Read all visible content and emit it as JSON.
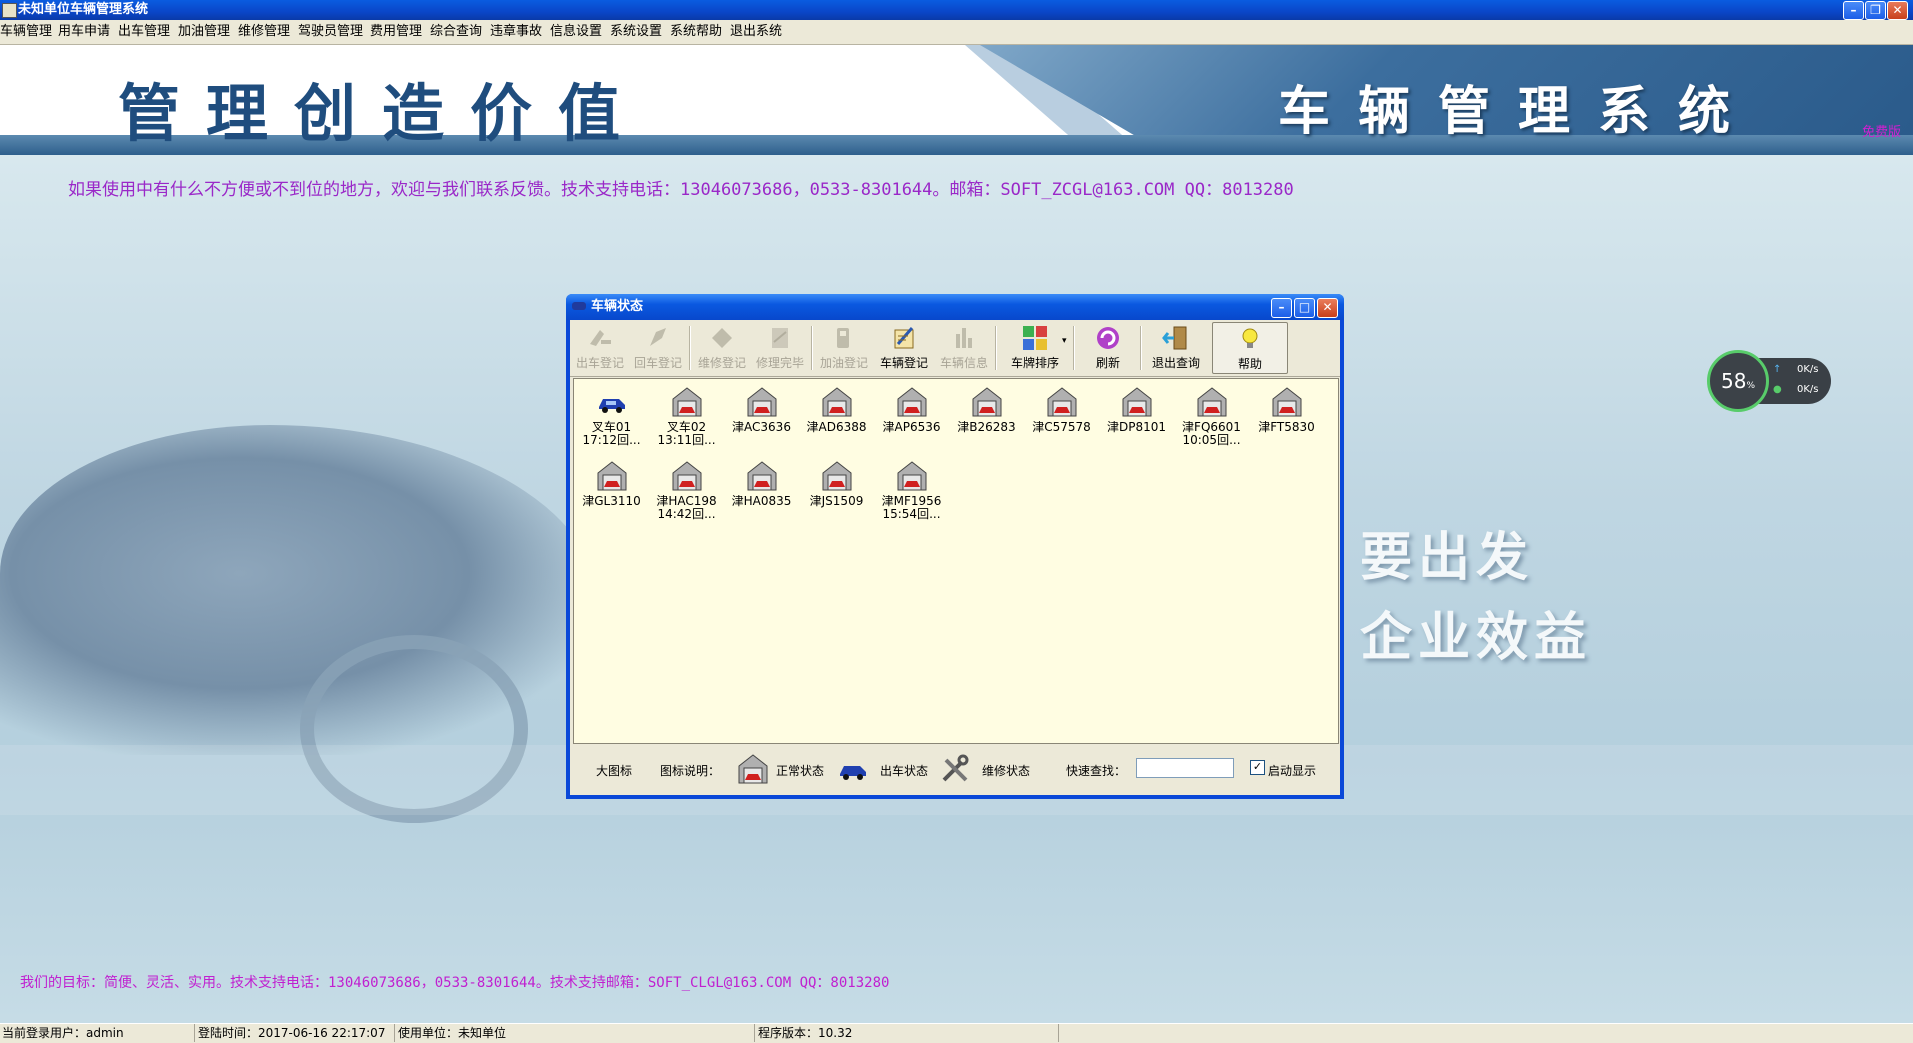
{
  "window": {
    "title": "未知单位车辆管理系统"
  },
  "menu": [
    "车辆管理",
    "用车申请",
    "出车管理",
    "加油管理",
    "维修管理",
    "驾驶员管理",
    "费用管理",
    "综合查询",
    "违章事故",
    "信息设置",
    "系统设置",
    "系统帮助",
    "退出系统"
  ],
  "banner": {
    "slogan": "管理创造价值",
    "system_name": "车辆管理系统",
    "corner_link": "免费版"
  },
  "notice_top": "如果使用中有什么不方便或不到位的地方，欢迎与我们联系反馈。技术支持电话：13046073686，0533-8301644。邮箱：SOFT_ZCGL@163.COM QQ：8013280",
  "notice_bottom": "我们的目标：简便、灵活、实用。技术支持电话：13046073686，0533-8301644。技术支持邮箱：SOFT_CLGL@163.COM QQ：8013280",
  "background_text": {
    "line1": "要出发",
    "line2": "企业效益"
  },
  "speed_widget": {
    "percent": "58",
    "unit": "%",
    "up": "0K/s",
    "down": "0K/s"
  },
  "dialog": {
    "title": "车辆状态",
    "toolbar": [
      {
        "label": "出车登记",
        "icon": "depart-icon",
        "enabled": false
      },
      {
        "label": "回车登记",
        "icon": "return-icon",
        "enabled": false
      },
      {
        "label": "维修登记",
        "icon": "repair-icon",
        "enabled": false
      },
      {
        "label": "修理完毕",
        "icon": "repair-done-icon",
        "enabled": false
      },
      {
        "label": "加油登记",
        "icon": "fuel-icon",
        "enabled": false
      },
      {
        "label": "车辆登记",
        "icon": "register-icon",
        "enabled": true
      },
      {
        "label": "车辆信息",
        "icon": "info-icon",
        "enabled": false
      },
      {
        "label": "车牌排序",
        "icon": "sort-icon",
        "enabled": true
      },
      {
        "label": "刷新",
        "icon": "refresh-icon",
        "enabled": true
      },
      {
        "label": "退出查询",
        "icon": "exit-icon",
        "enabled": true
      },
      {
        "label": "帮助",
        "icon": "help-icon",
        "enabled": true
      }
    ],
    "vehicles": [
      {
        "label": "叉车01\n17:12回...",
        "status": "out"
      },
      {
        "label": "叉车02\n13:11回...",
        "status": "normal"
      },
      {
        "label": "津AC3636",
        "status": "normal"
      },
      {
        "label": "津AD6388",
        "status": "normal"
      },
      {
        "label": "津AP6536",
        "status": "normal"
      },
      {
        "label": "津B26283",
        "status": "normal"
      },
      {
        "label": "津C57578",
        "status": "normal"
      },
      {
        "label": "津DP8101",
        "status": "normal"
      },
      {
        "label": "津FQ6601\n10:05回...",
        "status": "normal"
      },
      {
        "label": "津FT5830",
        "status": "normal"
      },
      {
        "label": "津GL3110",
        "status": "normal"
      },
      {
        "label": "津HAC198\n14:42回...",
        "status": "normal"
      },
      {
        "label": "津HA0835",
        "status": "normal"
      },
      {
        "label": "津JS1509",
        "status": "normal"
      },
      {
        "label": "津MF1956\n15:54回...",
        "status": "normal"
      }
    ],
    "legend": {
      "view_mode": "大图标",
      "title": "图标说明：",
      "normal": "正常状态",
      "out": "出车状态",
      "repair": "维修状态",
      "search_label": "快速查找：",
      "search_value": "",
      "startup_label": "启动显示",
      "startup_checked": true
    }
  },
  "status_bar": {
    "user": "当前登录用户：admin",
    "login_time": "登陆时间：2017-06-16 22:17:07",
    "unit": "使用单位：未知单位",
    "version": "程序版本：10.32"
  }
}
